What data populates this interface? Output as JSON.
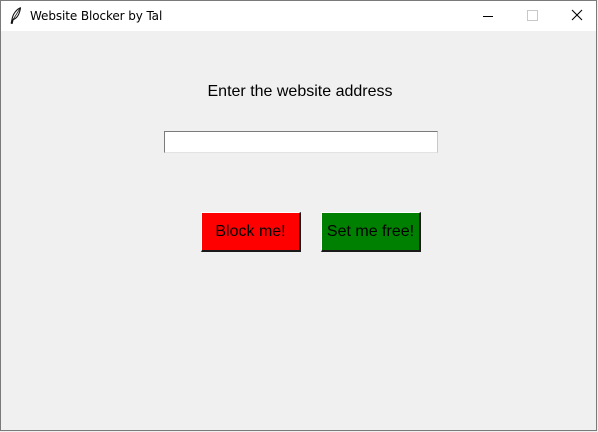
{
  "window": {
    "title": "Website Blocker by Tal",
    "icon": "feather-icon",
    "controls": [
      "minimize-icon",
      "maximize-icon",
      "close-icon"
    ]
  },
  "main": {
    "prompt": "Enter the website address",
    "url_input": {
      "value": "",
      "placeholder": ""
    },
    "block_button": {
      "label": "Block me!",
      "color": "#ff0000"
    },
    "free_button": {
      "label": "Set me free!",
      "color": "#008000"
    }
  }
}
